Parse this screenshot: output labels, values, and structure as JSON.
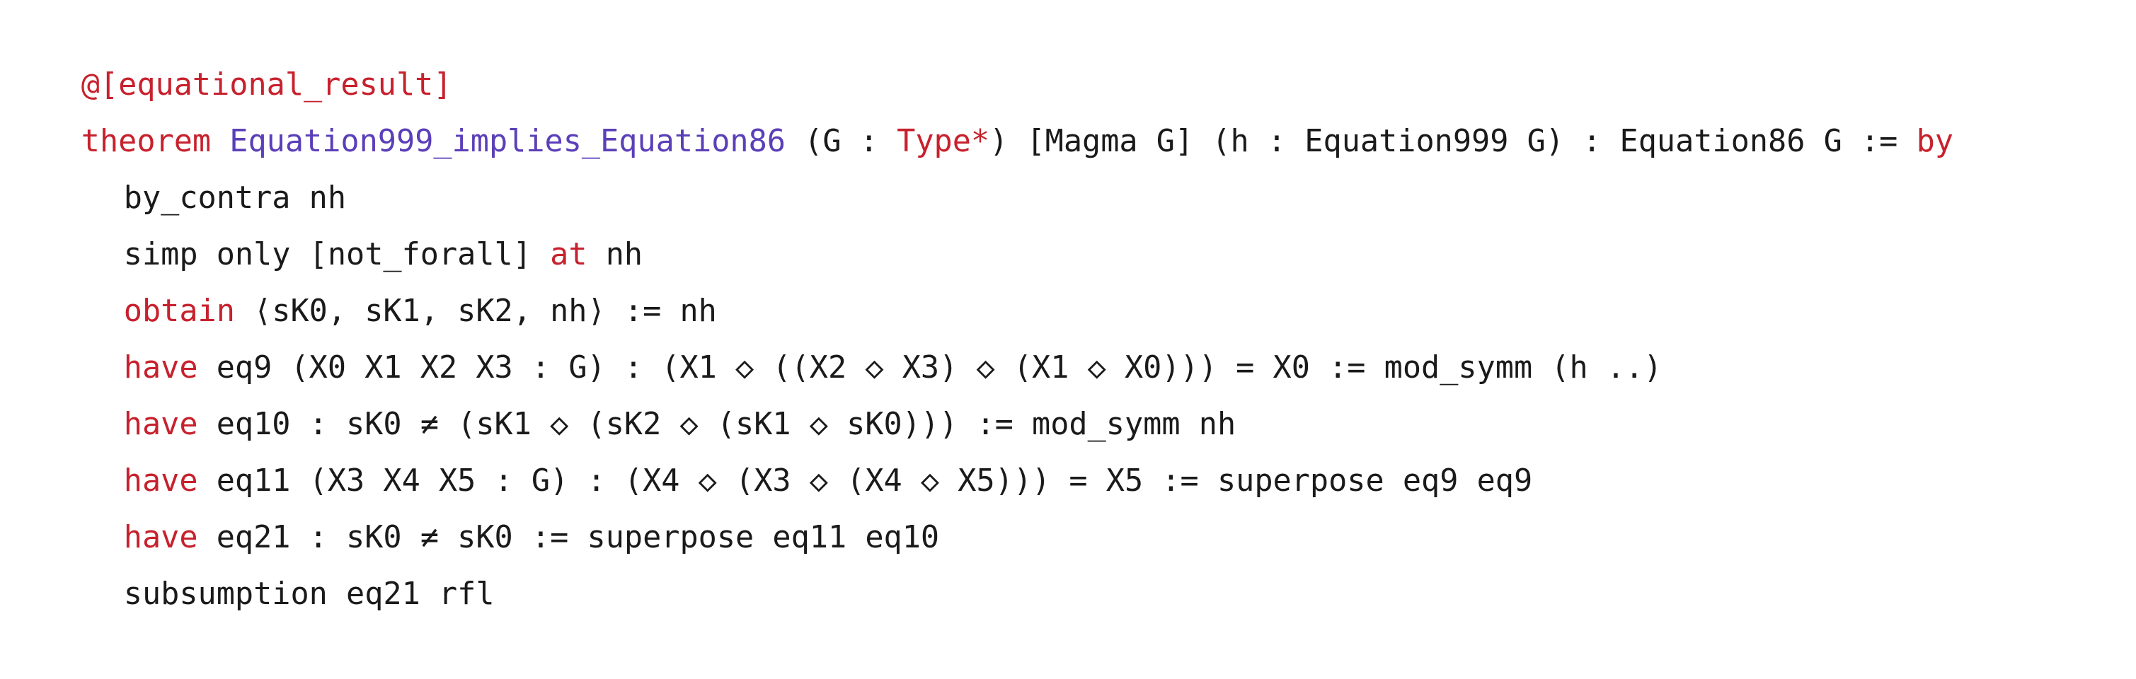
{
  "colors": {
    "keyword": "#c7212d",
    "theorem_name": "#5b3fb8",
    "text": "#1a1a1a",
    "background": "#ffffff"
  },
  "lines": {
    "l0": {
      "attr": "@[equational_result]"
    },
    "l1": {
      "kw": "theorem",
      "name": "Equation999_implies_Equation86",
      "p1": "(G : ",
      "type_kw": "Type*",
      "p2": ") [Magma G] (h : Equation999 G) : Equation86 G := ",
      "by_kw": "by"
    },
    "l2": {
      "text": "by_contra nh"
    },
    "l3": {
      "p1": "simp only [not_forall] ",
      "kw": "at",
      "p2": " nh"
    },
    "l4": {
      "kw": "obtain",
      "p1": " ⟨sK0, sK1, sK2, nh⟩ := nh"
    },
    "l5": {
      "kw": "have",
      "p1": " eq9 (X0 X1 X2 X3 : G) : (X1 ◇ ((X2 ◇ X3) ◇ (X1 ◇ X0))) = X0 := mod_symm (h ..)"
    },
    "l6": {
      "kw": "have",
      "p1": " eq10 : sK0 ≠ (sK1 ◇ (sK2 ◇ (sK1 ◇ sK0))) := mod_symm nh"
    },
    "l7": {
      "kw": "have",
      "p1": " eq11 (X3 X4 X5 : G) : (X4 ◇ (X3 ◇ (X4 ◇ X5))) = X5 := superpose eq9 eq9"
    },
    "l8": {
      "kw": "have",
      "p1": " eq21 : sK0 ≠ sK0 := superpose eq11 eq10"
    },
    "l9": {
      "text": "subsumption eq21 rfl"
    }
  }
}
